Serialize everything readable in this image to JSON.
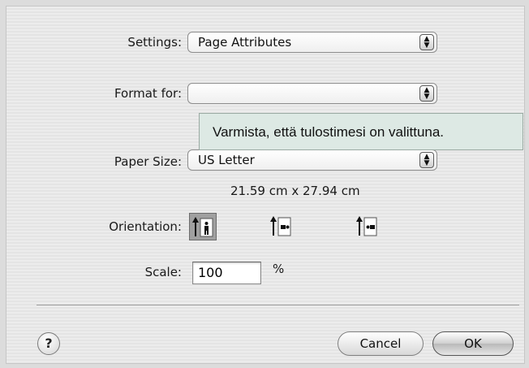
{
  "settings": {
    "label": "Settings:",
    "value": "Page Attributes"
  },
  "format_for": {
    "label": "Format for:",
    "value": ""
  },
  "tooltip": {
    "text": "Varmista, että tulostimesi on valittuna."
  },
  "paper_size": {
    "label": "Paper Size:",
    "value": "US Letter",
    "dimensions": "21.59 cm x 27.94 cm"
  },
  "orientation": {
    "label": "Orientation:",
    "options": [
      {
        "name": "portrait",
        "icon": "portrait-orientation-icon",
        "selected": true
      },
      {
        "name": "landscape",
        "icon": "landscape-orientation-icon",
        "selected": false
      },
      {
        "name": "reverse-landscape",
        "icon": "reverse-landscape-orientation-icon",
        "selected": false
      }
    ]
  },
  "scale": {
    "label": "Scale:",
    "value": "100",
    "unit": "%"
  },
  "buttons": {
    "help": "?",
    "cancel": "Cancel",
    "ok": "OK"
  },
  "colors": {
    "tooltip_bg": "#dde9e4",
    "selected_orientation_bg": "#a0a0a0"
  }
}
